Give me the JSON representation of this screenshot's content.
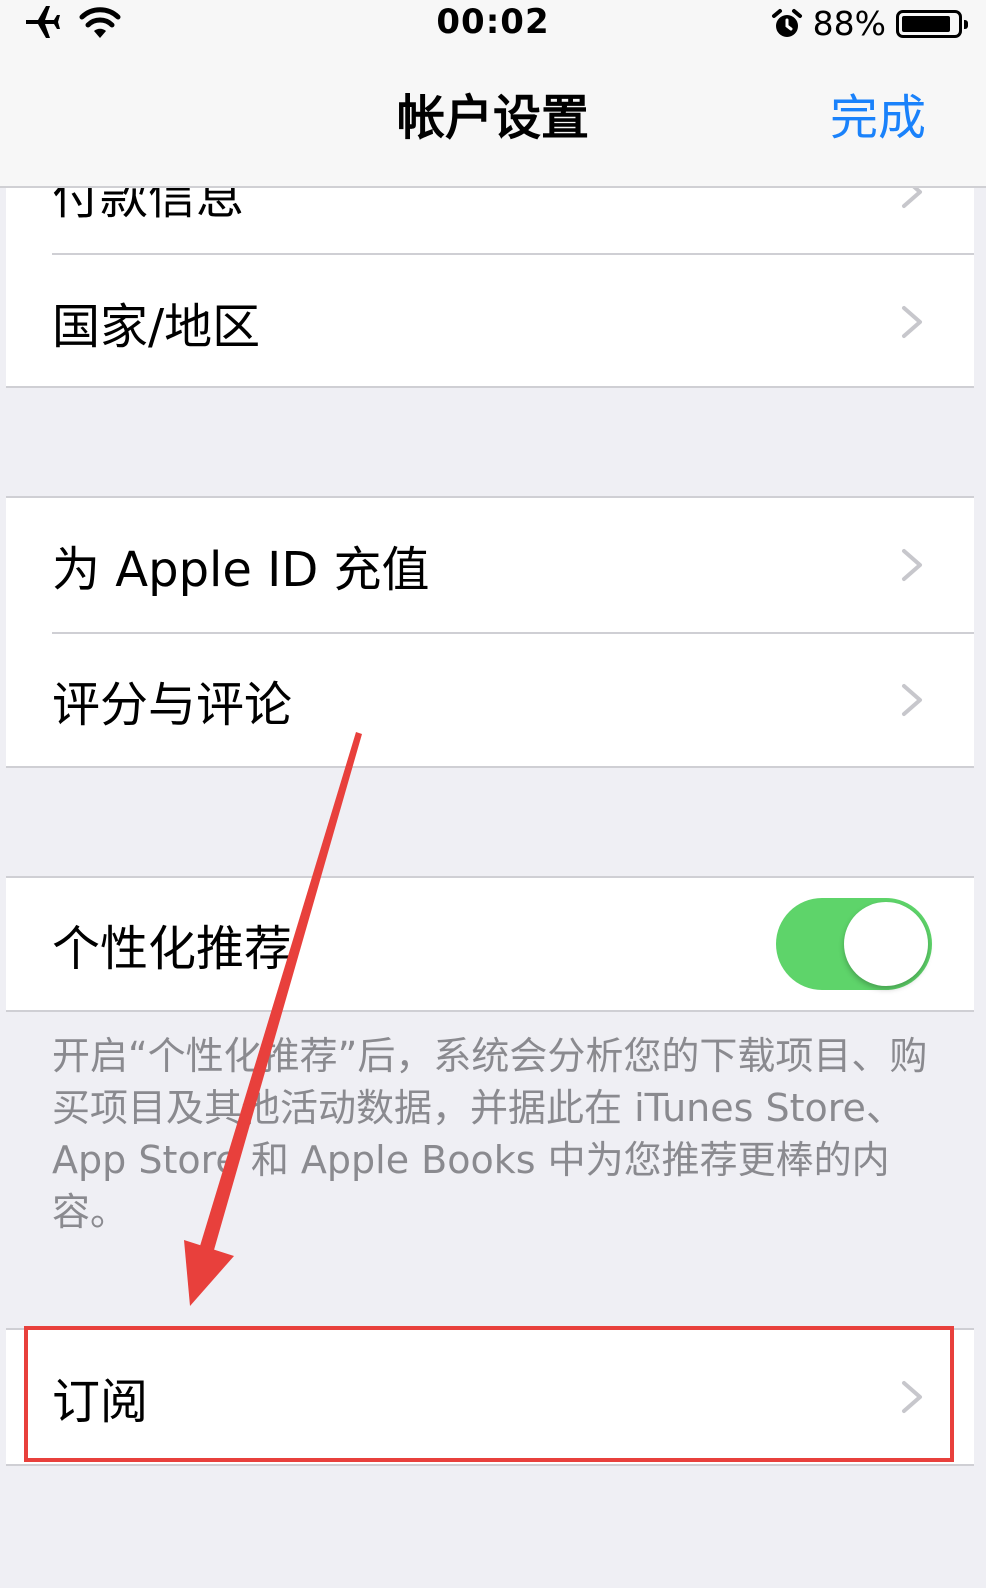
{
  "status_bar": {
    "time": "00:02",
    "battery_percent": "88%",
    "battery_level": 0.88,
    "icons": [
      "airplane-icon",
      "wifi-icon",
      "alarm-icon",
      "battery-icon"
    ]
  },
  "nav": {
    "title": "帐户设置",
    "done_label": "完成"
  },
  "rows": {
    "payment_partial": "付款信息",
    "country_region": "国家/地区",
    "recharge_apple_id": "为 Apple ID 充值",
    "ratings_reviews": "评分与评论",
    "personalized_recommendations": "个性化推荐",
    "personalized_enabled": true,
    "subscriptions": "订阅"
  },
  "footnote": "开启“个性化推荐”后，系统会分析您的下载项目、购买项目及其他活动数据，并据此在 iTunes Store、App Store 和 Apple Books 中为您推荐更棒的内容。",
  "colors": {
    "accent": "#1a82fb",
    "toggle_on": "#5ed46a",
    "annotation": "#e8403c",
    "background": "#efeff4"
  }
}
